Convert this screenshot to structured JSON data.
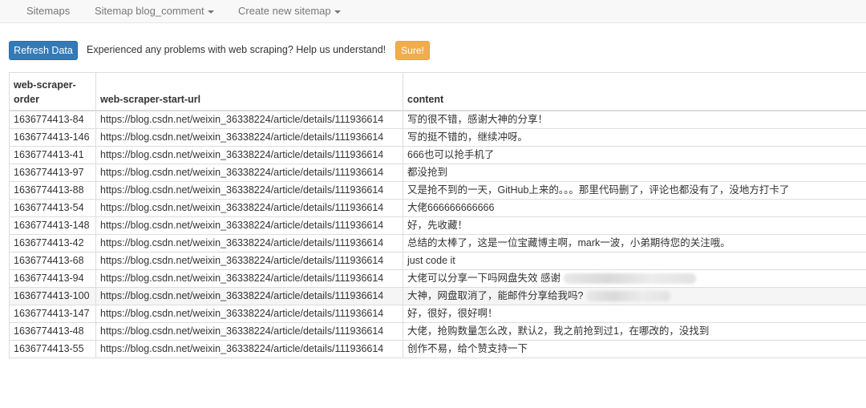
{
  "nav": {
    "items": [
      {
        "label": "Sitemaps",
        "dropdown": false
      },
      {
        "label": "Sitemap blog_comment",
        "dropdown": true
      },
      {
        "label": "Create new sitemap",
        "dropdown": true
      }
    ]
  },
  "toolbar": {
    "refresh_label": "Refresh Data",
    "message": "Experienced any problems with web scraping? Help us understand!",
    "sure_label": "Sure!"
  },
  "colors": {
    "primary": "#337ab7",
    "warning": "#f0ad4e",
    "navbar_bg": "#f8f8f8",
    "border": "#dddddd"
  },
  "table": {
    "headers": [
      "web-scraper-order",
      "web-scraper-start-url",
      "content"
    ],
    "rows": [
      {
        "order": "1636774413-84",
        "url": "https://blog.csdn.net/weixin_36338224/article/details/111936614",
        "content": "写的很不错，感谢大神的分享！"
      },
      {
        "order": "1636774413-146",
        "url": "https://blog.csdn.net/weixin_36338224/article/details/111936614",
        "content": "写的挺不错的，继续冲呀。"
      },
      {
        "order": "1636774413-41",
        "url": "https://blog.csdn.net/weixin_36338224/article/details/111936614",
        "content": "666也可以抢手机了"
      },
      {
        "order": "1636774413-97",
        "url": "https://blog.csdn.net/weixin_36338224/article/details/111936614",
        "content": "都没抢到"
      },
      {
        "order": "1636774413-88",
        "url": "https://blog.csdn.net/weixin_36338224/article/details/111936614",
        "content": "又是抢不到的一天，GitHub上来的。。。那里代码删了，评论也都没有了，没地方打卡了"
      },
      {
        "order": "1636774413-54",
        "url": "https://blog.csdn.net/weixin_36338224/article/details/111936614",
        "content": "大佬666666666666"
      },
      {
        "order": "1636774413-148",
        "url": "https://blog.csdn.net/weixin_36338224/article/details/111936614",
        "content": "好，先收藏！"
      },
      {
        "order": "1636774413-42",
        "url": "https://blog.csdn.net/weixin_36338224/article/details/111936614",
        "content": "总结的太棒了，这是一位宝藏博主啊，mark一波，小弟期待您的关注哦。"
      },
      {
        "order": "1636774413-68",
        "url": "https://blog.csdn.net/weixin_36338224/article/details/111936614",
        "content": "just code it"
      },
      {
        "order": "1636774413-94",
        "url": "https://blog.csdn.net/weixin_36338224/article/details/111936614",
        "content": "大佬可以分享一下吗网盘失效 感谢",
        "redacted": true
      },
      {
        "order": "1636774413-100",
        "url": "https://blog.csdn.net/weixin_36338224/article/details/111936614",
        "content": "大神，网盘取消了，能邮件分享给我吗?",
        "redacted": true
      },
      {
        "order": "1636774413-147",
        "url": "https://blog.csdn.net/weixin_36338224/article/details/111936614",
        "content": "好，很好，很好啊！"
      },
      {
        "order": "1636774413-48",
        "url": "https://blog.csdn.net/weixin_36338224/article/details/111936614",
        "content": "大佬，抢购数量怎么改，默认2，我之前抢到过1，在哪改的，没找到"
      },
      {
        "order": "1636774413-55",
        "url": "https://blog.csdn.net/weixin_36338224/article/details/111936614",
        "content": "创作不易，给个赞支持一下"
      }
    ]
  }
}
